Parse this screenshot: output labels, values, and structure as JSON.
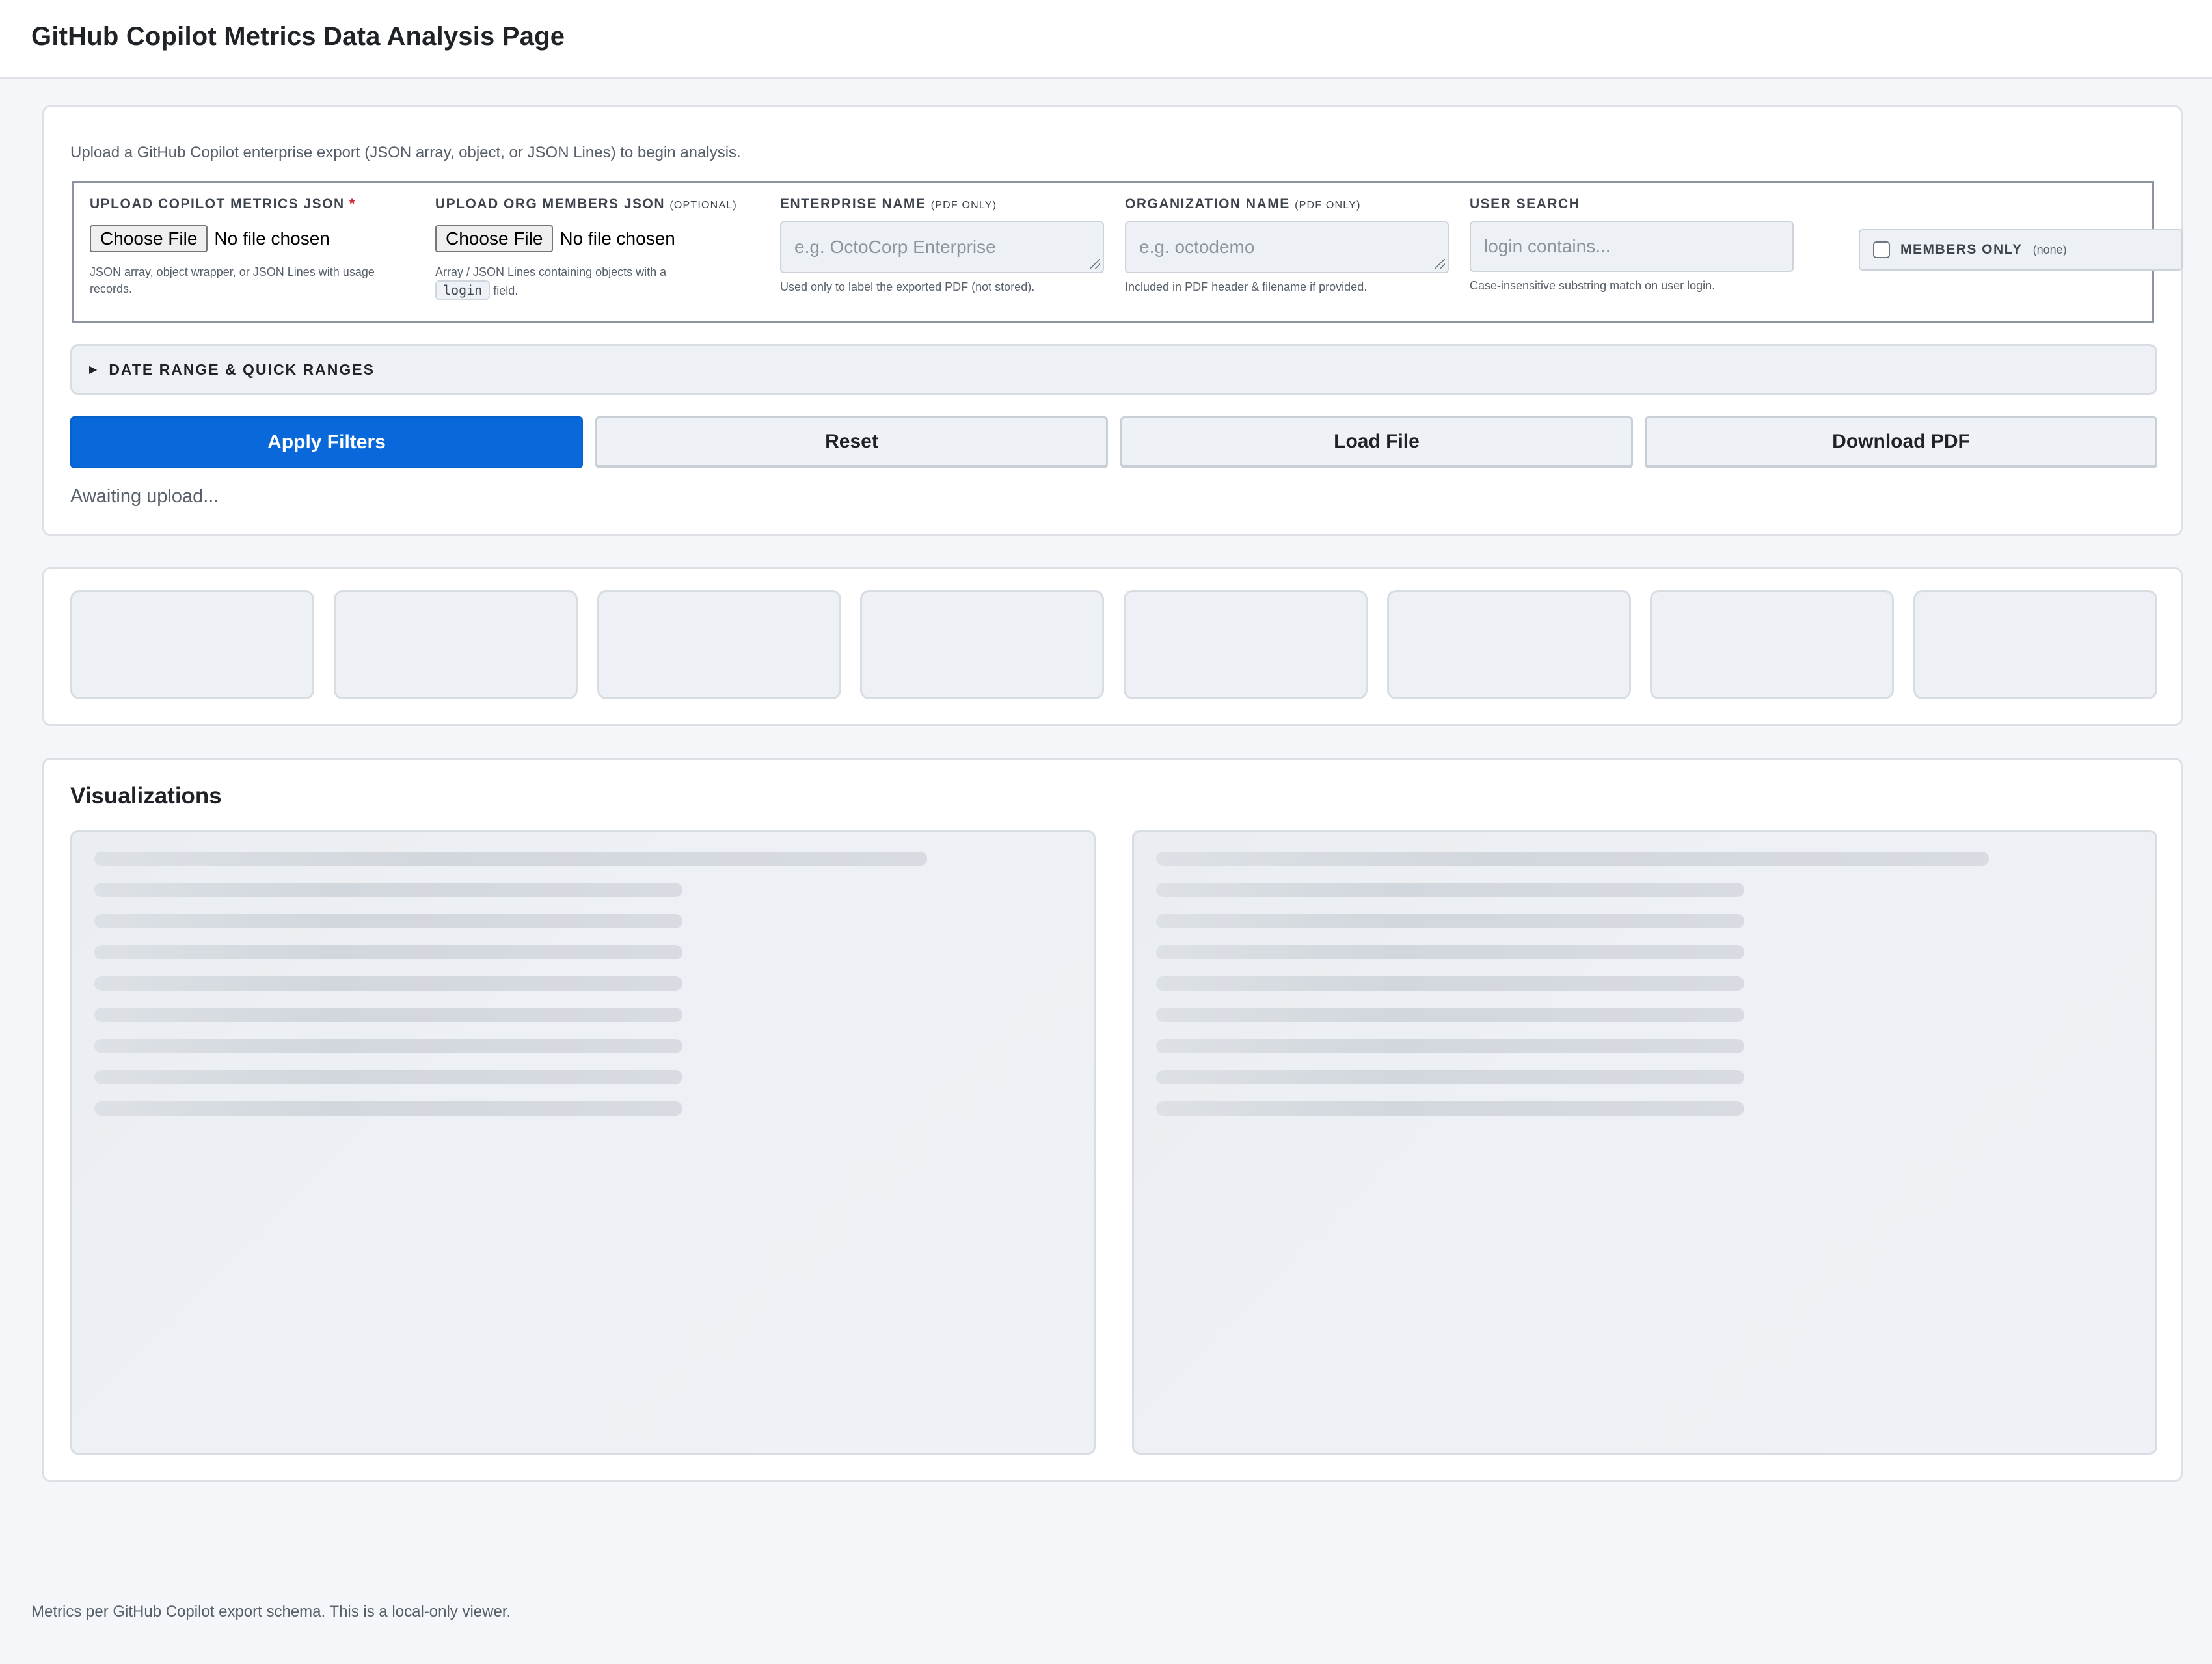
{
  "header": {
    "title": "GitHub Copilot Metrics Data Analysis Page"
  },
  "upload": {
    "intro": "Upload a GitHub Copilot enterprise export (JSON array, object, or JSON Lines) to begin analysis.",
    "metrics_file": {
      "label": "UPLOAD COPILOT METRICS JSON",
      "required_mark": "*",
      "button": "Choose File",
      "status": "No file chosen",
      "help": "JSON array, object wrapper, or JSON Lines with usage records."
    },
    "members_file": {
      "label": "UPLOAD ORG MEMBERS JSON",
      "label_sub": "(OPTIONAL)",
      "button": "Choose File",
      "status": "No file chosen",
      "help_before": "Array / JSON Lines containing objects with a",
      "help_code": "login",
      "help_after": "field."
    },
    "enterprise_name": {
      "label": "ENTERPRISE NAME",
      "label_sub": "(PDF ONLY)",
      "placeholder": "e.g. OctoCorp Enterprise",
      "help": "Used only to label the exported PDF (not stored)."
    },
    "organization_name": {
      "label": "ORGANIZATION NAME",
      "label_sub": "(PDF ONLY)",
      "placeholder": "e.g. octodemo",
      "help": "Included in PDF header & filename if provided."
    },
    "user_search": {
      "label": "USER SEARCH",
      "placeholder": "login contains...",
      "help": "Case-insensitive substring match on user login."
    },
    "members_only": {
      "label": "MEMBERS ONLY",
      "value": "(none)",
      "checked": false
    },
    "date_range": {
      "toggle_icon": "triangle-right-icon",
      "label": "DATE RANGE & QUICK RANGES"
    },
    "buttons": {
      "apply": "Apply Filters",
      "reset": "Reset",
      "load": "Load File",
      "download": "Download PDF"
    },
    "status": "Awaiting upload..."
  },
  "kpis": {
    "placeholder_count": 8
  },
  "visualizations": {
    "title": "Visualizations"
  },
  "footer": {
    "text": "Metrics per GitHub Copilot export schema. This is a local-only viewer."
  },
  "colors": {
    "primary": "#0969da",
    "required": "#cf222e",
    "page_bg": "#f5f6f9",
    "skeleton": "#d5dae0"
  }
}
